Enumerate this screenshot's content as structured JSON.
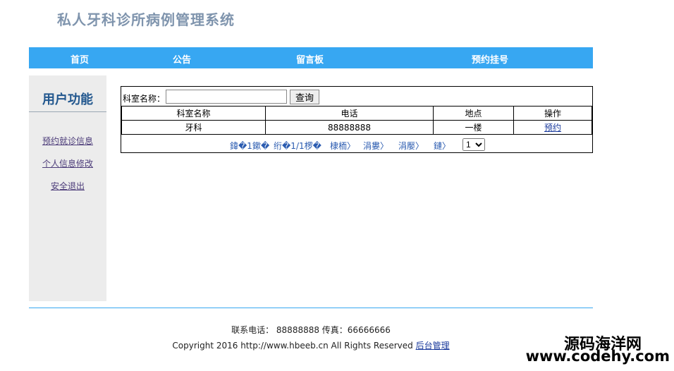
{
  "site": {
    "title": "私人牙科诊所病例管理系统"
  },
  "nav": [
    {
      "label": "首页"
    },
    {
      "label": "公告"
    },
    {
      "label": "留言板"
    },
    {
      "label": "预约挂号"
    }
  ],
  "sidebar": {
    "heading": "用户功能",
    "items": [
      {
        "label": "预约就诊信息"
      },
      {
        "label": "个人信息修改"
      },
      {
        "label": "安全退出"
      }
    ]
  },
  "search": {
    "label": "科室名称：",
    "value": "",
    "button": "查询"
  },
  "table": {
    "headers": [
      "科室名称",
      "电话",
      "地点",
      "操作"
    ],
    "rows": [
      {
        "name": "牙科",
        "phone": "88888888",
        "location": "一楼",
        "action": "预约"
      }
    ]
  },
  "pager": {
    "items": [
      "鍏�1鏉�",
      "绗�1/1椤�",
      "棣栭〉",
      "涓婁〉",
      "涓嬮〉",
      "鏈〉"
    ],
    "selected": "1"
  },
  "footer": {
    "contact": "联系电话： 88888888 传真：66666666",
    "copyright": "Copyright 2016 http://www.hbeeb.cn All Rights Reserved",
    "admin_link": "后台管理"
  },
  "watermark": {
    "line1": "源码海洋网",
    "line2": "www.codehy.com"
  }
}
